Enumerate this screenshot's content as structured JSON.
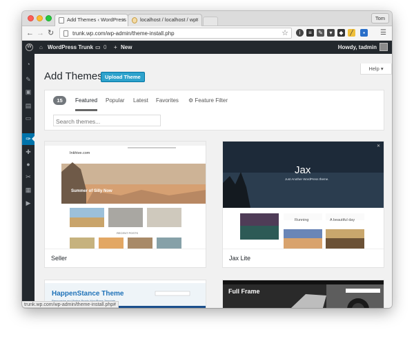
{
  "browser": {
    "tabs": [
      {
        "label": "Add Themes ‹ WordPress"
      },
      {
        "label": "localhost / localhost / wpt"
      }
    ],
    "profile": "Tom",
    "url": "trunk.wp.com/wp-admin/theme-install.php",
    "status_url": "trunk.wp.com/wp-admin/theme-install.php#"
  },
  "adminbar": {
    "site_name": "WordPress Trunk",
    "comments_count": "0",
    "new_label": "New",
    "greeting": "Howdy, tadmin"
  },
  "page": {
    "title": "Add Themes",
    "upload_label": "Upload Theme",
    "help_label": "Help"
  },
  "filter": {
    "count": "15",
    "tabs": [
      "Featured",
      "Popular",
      "Latest",
      "Favorites"
    ],
    "feature_filter": "Feature Filter",
    "search_placeholder": "Search themes..."
  },
  "themes": [
    {
      "name": "Seller",
      "hero_text": "Summer of Silly Now",
      "site_title": "Inkhive.com",
      "recent": "RECENT POSTS"
    },
    {
      "name": "Jax Lite",
      "hero_title": "Jax",
      "hero_sub": "Just Another WordPress theme.",
      "post1": "Running",
      "post2": "A beautiful day"
    },
    {
      "name": "HappenStance Theme",
      "hero_title": "HappenStance Theme",
      "hero_sub": "Responsive and Retina Ready WordPress Template"
    },
    {
      "name": "Full Frame",
      "hero_title": "Full Frame"
    }
  ],
  "colors": {
    "admin_dark": "#23282d",
    "accent": "#0073aa",
    "upload_button": "#2ea2cc"
  }
}
